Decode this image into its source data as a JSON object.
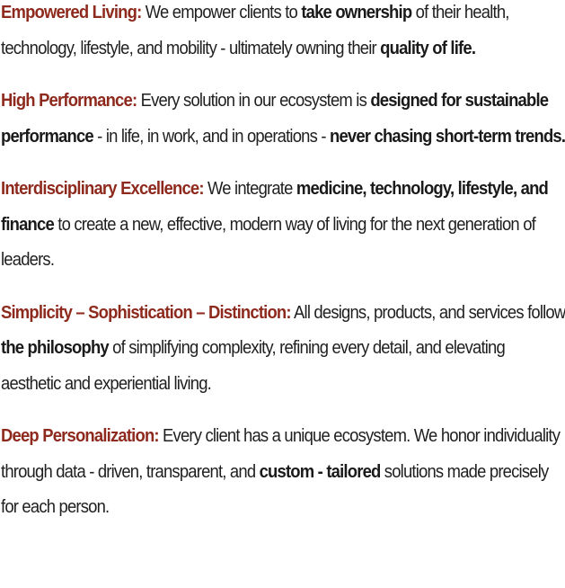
{
  "principles": [
    {
      "lead": "Empowered Living:",
      "segments": [
        {
          "t": " We empower clients to ",
          "b": false
        },
        {
          "t": "take ownership",
          "b": true
        },
        {
          "t": " of their health, technology, lifestyle, and mobility - ultimately owning their ",
          "b": false
        },
        {
          "t": "quality of life.",
          "b": true
        }
      ]
    },
    {
      "lead": "High Performance:",
      "segments": [
        {
          "t": " Every solution in our ecosystem is ",
          "b": false
        },
        {
          "t": "designed for sustainable performance",
          "b": true
        },
        {
          "t": " - in life, in work, and in operations - ",
          "b": false
        },
        {
          "t": "never chasing short-term trends.",
          "b": true
        }
      ]
    },
    {
      "lead": "Interdisciplinary Excellence:",
      "segments": [
        {
          "t": " We integrate ",
          "b": false
        },
        {
          "t": "medicine, technology, lifestyle, and finance",
          "b": true
        },
        {
          "t": " to create a new, effective, modern way of living for the next generation of leaders.",
          "b": false
        }
      ]
    },
    {
      "lead": "Simplicity – Sophistication – Distinction:",
      "segments": [
        {
          "t": " All designs, products, and services follow ",
          "b": false
        },
        {
          "t": "the philosophy",
          "b": true
        },
        {
          "t": " of simplifying complexity, refining every detail, and elevating aesthetic and experiential living.",
          "b": false
        }
      ]
    },
    {
      "lead": "Deep Personalization:",
      "segments": [
        {
          "t": " Every client has a unique ecosystem. We honor individuality through data - driven, transparent, and ",
          "b": false
        },
        {
          "t": "custom - tailored",
          "b": true
        },
        {
          "t": " solutions made precisely for each person.",
          "b": false
        }
      ]
    }
  ],
  "colors": {
    "lead_heading": "#8e2a1d",
    "body_text": "#1f1f1f"
  }
}
